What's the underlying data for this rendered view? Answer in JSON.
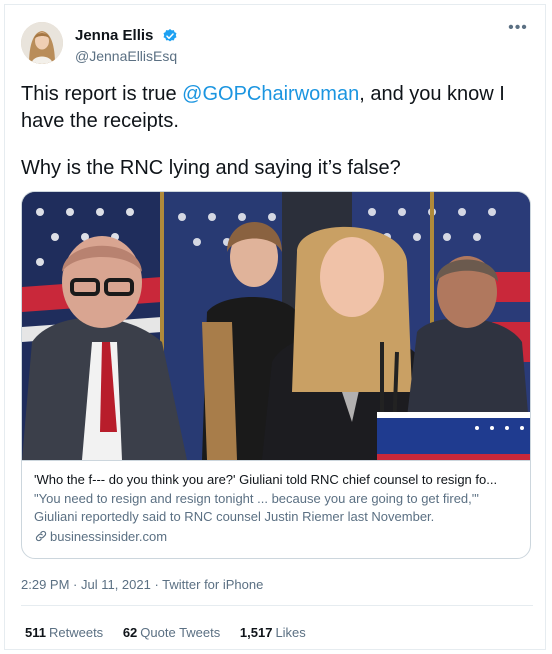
{
  "author": {
    "display_name": "Jenna Ellis",
    "handle": "@JennaEllisEsq",
    "verified_icon": "verified-badge-icon",
    "more_label": "•••"
  },
  "tweet": {
    "text_before_mention": "This report is true ",
    "mention": "@GOPChairwoman",
    "text_after_mention": ", and you know I have the receipts.",
    "second_paragraph": "Why is the RNC lying and saying it’s false?"
  },
  "card": {
    "title": "'Who the f--- do you think you are?' Giuliani told RNC chief counsel to resign fo...",
    "description": "\"You need to resign and resign tonight ... because you are going to get fired,'\" Giuliani reportedly said to RNC counsel Justin Riemer last November.",
    "domain": "businessinsider.com",
    "link_icon": "link-icon"
  },
  "meta": {
    "timestamp": "2:29 PM · Jul 11, 2021",
    "separator": " · ",
    "source": "Twitter for iPhone"
  },
  "stats": {
    "retweets_count": "511",
    "retweets_label": "Retweets",
    "quotes_count": "62",
    "quotes_label": "Quote Tweets",
    "likes_count": "1,517",
    "likes_label": "Likes"
  },
  "colors": {
    "link_blue": "#1b95e0",
    "verified_blue": "#1da1f2",
    "secondary_text": "#5b7083",
    "border": "#ccd6dd"
  }
}
